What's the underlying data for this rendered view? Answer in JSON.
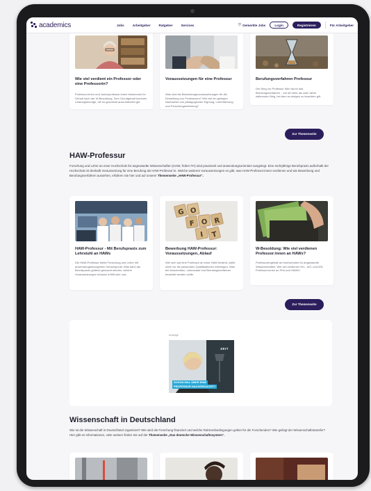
{
  "nav": {
    "logo_text": "academics",
    "links": [
      "Jobs",
      "Arbeitgeber",
      "Ratgeber",
      "Services"
    ],
    "favorites_label": "Gemerkte Jobs",
    "login_label": "Login",
    "register_label": "Registrieren",
    "employer_label": "Für Arbeitgeber",
    "brand_color": "#2c1e5c"
  },
  "top_cards": [
    {
      "title": "Wie viel verdient ein Professor oder eine Professorin?",
      "text": "Professor:innen und Juniorprofessor:innen bekommen ihr Gehalt nach der W-Besoldung. Zum Grundgehalt kommen Leistungsbezüge, die es geschickt auszuhandeln gilt."
    },
    {
      "title": "Voraussetzungen für eine Professur",
      "text": "Was sind die Bewerbungsvoraussetzungen für die Einstellung von Professoren? Wie viel ein gelingen Nachweise von pädagogischer Eignung, Lehrerfahrung und Forschungserfahrung?"
    },
    {
      "title": "Berufungsverfahren Professur",
      "text": "Der Weg zur Professur führt durch das Berufungsverfahren – ein oft mehr als zwei Jahre währender Weg, bei dem es einiges zu beachten gilt."
    }
  ],
  "topic_button_1": "Zur Themenseite",
  "haw": {
    "heading": "HAW-Professur",
    "intro": "Forschung und Lehre an einer Hochschule für angewandte Wissenschaften (HAW, früher FH) sind praxisnah und anwendungsorientiert ausgelegt. Eine mehrjährige Berufspraxis außerhalb der Hochschule ist deshalb Voraussetzung für eine Berufung als HAW-Professor:in. Welche weiteren Voraussetzungen es gibt, was HAW-Professor:innen verdienen und wie Bewerbung und Berufungsverfahren aussehen, erfahren Sie hier und auf unserer",
    "intro_link": "Themenseite „HAW-Professur“.",
    "cards": [
      {
        "title": "HAW-Professur - Mit Berufspraxis zum Lehrstuhl an HAWs",
        "text": "Die HAW-Professur bietet Forschung und Lehre mit anwendungsbezogenem Schwerpunkt. Was kann als Berufspraxis geltend gemacht werden, welche Voraussetzungen müssen erfüllt sein und..."
      },
      {
        "title": "Bewerbung HAW-Professur: Voraussetzungen, Ablauf",
        "text": "Wer sich auf eine Professur an einer HAW bewirbt, sollte nicht nur die passenden Qualifikationen mitbringen. Was bei Anschreiben, Lebenslauf und Berufungsverfahren beachtet werden sollte."
      },
      {
        "title": "W-Besoldung: Wie viel verdienen Professor:innen an HAWs?",
        "text": "Professorengehalt an Hochschulen für angewandte Wissenschaften: Wie viel verdienen W1-, W2- und W3-Professor:innen an FHs und HAWs?"
      }
    ],
    "scrabble_tiles": [
      "G",
      "O",
      "F",
      "O",
      "R",
      "I",
      "T"
    ]
  },
  "topic_button_2": "Zur Themenseite",
  "ad": {
    "label": "Anzeige",
    "brand": "ZEIT",
    "line1": "SCHON MAL ÜBER EINE",
    "line2": "PROFESSUR NACHGEDACHT?"
  },
  "wissenschaft": {
    "heading": "Wissenschaft in Deutschland",
    "intro": "Wie ist die Wissenschaft in Deutschland organisiert? Wie wird die Forschung finanziert und welche Rahmenbedingungen gelten für die Forschenden? Wie gelingt der Wissenschaftstransfer? Hier gibt es Informationen, viele weitere finden Sie auf der",
    "intro_link": "Themenseite „Das deutsche Wissenschaftssystem“."
  }
}
